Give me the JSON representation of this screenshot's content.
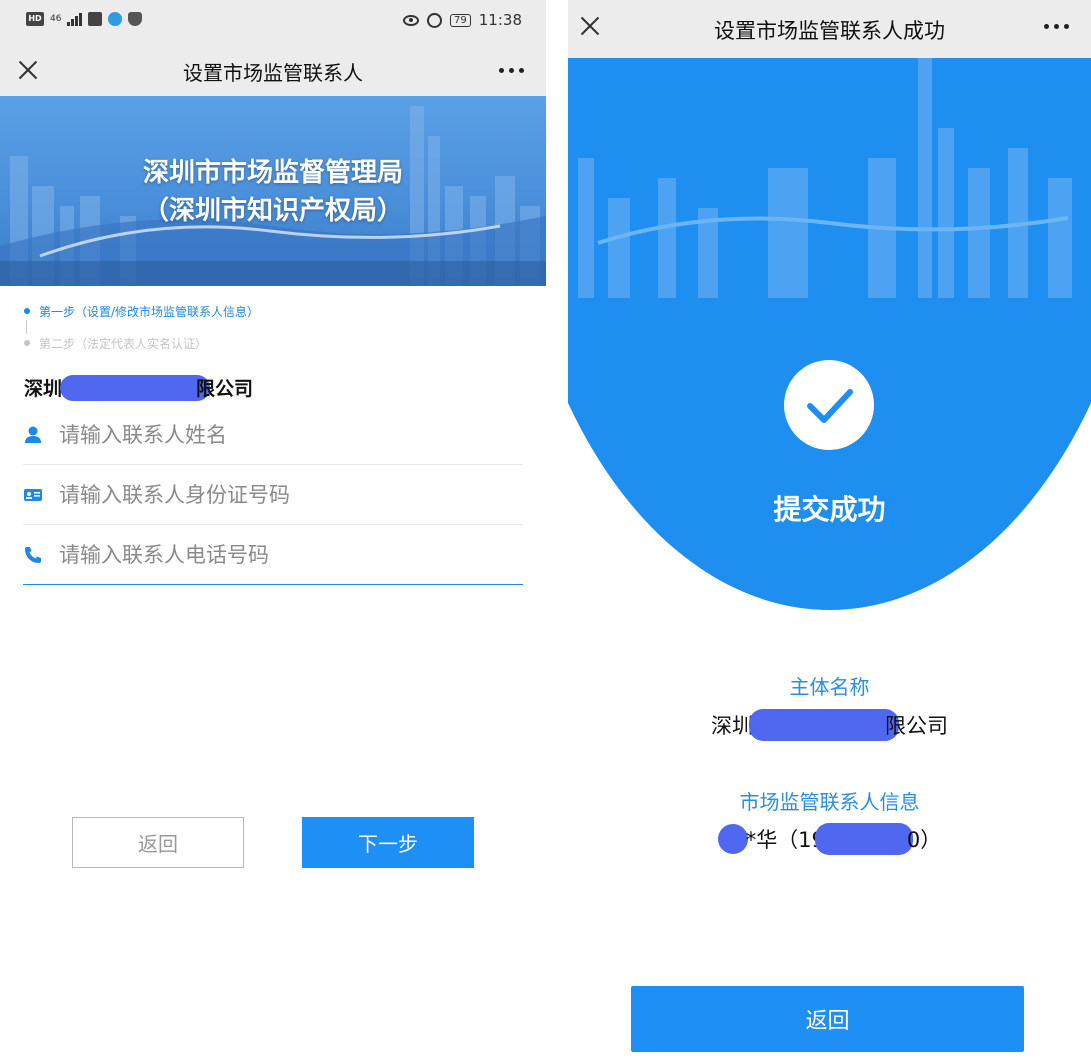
{
  "left": {
    "status_bar": {
      "network": "46",
      "time": "11:38",
      "battery": "79"
    },
    "navbar": {
      "title": "设置市场监管联系人"
    },
    "banner": {
      "line1": "深圳市市场监督管理局",
      "line2": "（深圳市知识产权局）"
    },
    "steps": [
      {
        "label": "第一步（设置/修改市场监管联系人信息）"
      },
      {
        "label": "第二步（法定代表人实名认证）"
      }
    ],
    "company": {
      "prefix": "深圳",
      "suffix": "限公司"
    },
    "form": {
      "name_placeholder": "请输入联系人姓名",
      "id_placeholder": "请输入联系人身份证号码",
      "phone_placeholder": "请输入联系人电话号码"
    },
    "buttons": {
      "back": "返回",
      "next": "下一步"
    }
  },
  "right": {
    "navbar": {
      "title": "设置市场监管联系人成功"
    },
    "success_text": "提交成功",
    "subject_label": "主体名称",
    "subject_prefix": "深圳",
    "subject_suffix": "限公司",
    "contact_label": "市场监管联系人信息",
    "contact_mid": "*华（19",
    "contact_end": "0）",
    "return_button": "返回"
  },
  "colors": {
    "accent": "#1e90f5",
    "redaction": "#5067f0",
    "navbar_bg": "#ececec"
  },
  "icons": [
    "close-icon",
    "more-icon",
    "user-icon",
    "id-card-icon",
    "phone-icon",
    "check-icon"
  ]
}
